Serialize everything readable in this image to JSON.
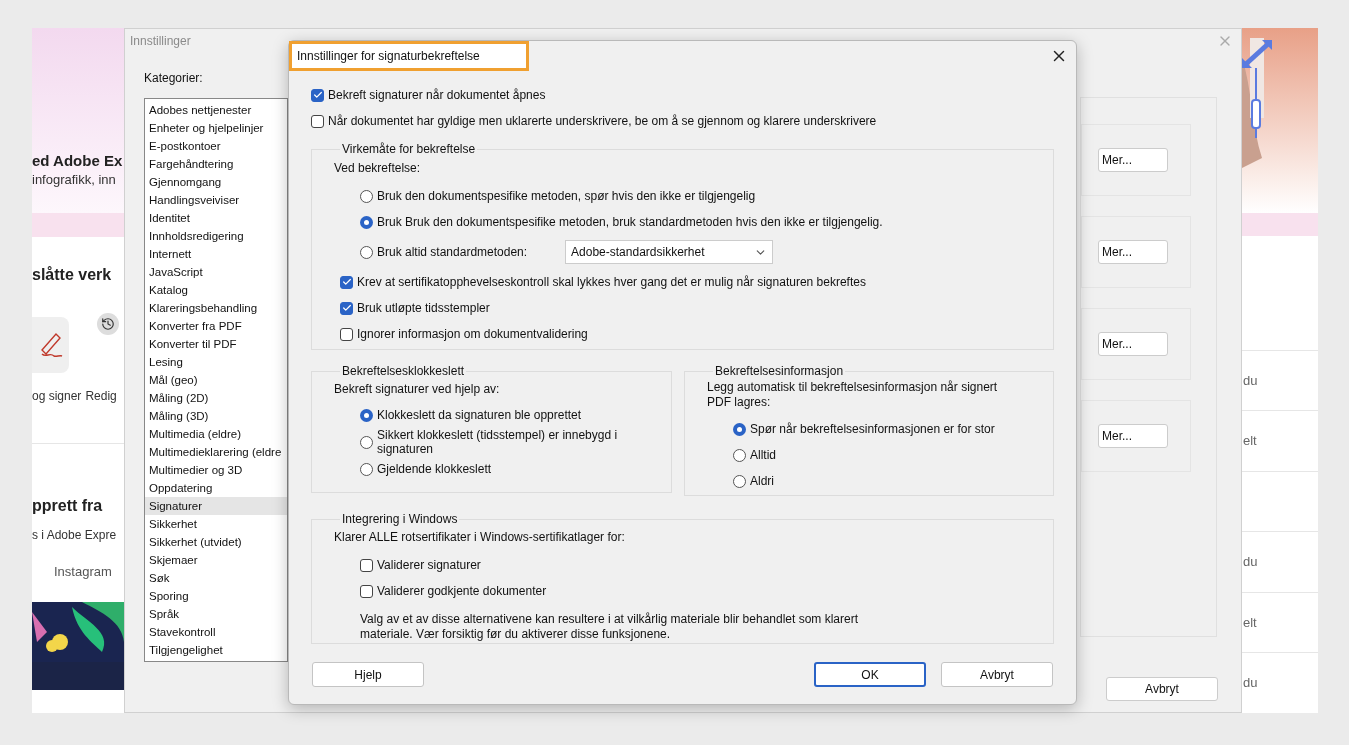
{
  "background_page": {
    "heading": "ed Adobe Ex",
    "subtitle": "infografikk, inn",
    "tools_title": "slåtte verk",
    "tools": [
      {
        "label": "og signer"
      },
      {
        "label": "Redig"
      }
    ],
    "create_title": "pprett fra",
    "create_subtitle": "s i Adobe Expre",
    "tab": "Instagram",
    "right_rows": [
      "du",
      "elt",
      "",
      "du",
      "elt",
      "du"
    ]
  },
  "settings_window": {
    "title": "Innstillinger",
    "categories_label": "Kategorier:",
    "categories": [
      {
        "label": "Adobes nettjenester",
        "selected": false
      },
      {
        "label": "Enheter og hjelpelinjer",
        "selected": false
      },
      {
        "label": "E-postkontoer",
        "selected": false
      },
      {
        "label": "Fargehåndtering",
        "selected": false
      },
      {
        "label": "Gjennomgang",
        "selected": false
      },
      {
        "label": "Handlingsveiviser",
        "selected": false
      },
      {
        "label": "Identitet",
        "selected": false
      },
      {
        "label": "Innholdsredigering",
        "selected": false
      },
      {
        "label": "Internett",
        "selected": false
      },
      {
        "label": "JavaScript",
        "selected": false
      },
      {
        "label": "Katalog",
        "selected": false
      },
      {
        "label": "Klareringsbehandling",
        "selected": false
      },
      {
        "label": "Konverter fra PDF",
        "selected": false
      },
      {
        "label": "Konverter til PDF",
        "selected": false
      },
      {
        "label": "Lesing",
        "selected": false
      },
      {
        "label": "Mål (geo)",
        "selected": false
      },
      {
        "label": "Måling (2D)",
        "selected": false
      },
      {
        "label": "Måling (3D)",
        "selected": false
      },
      {
        "label": "Multimedia (eldre)",
        "selected": false
      },
      {
        "label": "Multimedieklarering (eldre",
        "selected": false
      },
      {
        "label": "Multimedier og 3D",
        "selected": false
      },
      {
        "label": "Oppdatering",
        "selected": false
      },
      {
        "label": "Signaturer",
        "selected": true
      },
      {
        "label": "Sikkerhet",
        "selected": false
      },
      {
        "label": "Sikkerhet (utvidet)",
        "selected": false
      },
      {
        "label": "Skjemaer",
        "selected": false
      },
      {
        "label": "Søk",
        "selected": false
      },
      {
        "label": "Sporing",
        "selected": false
      },
      {
        "label": "Språk",
        "selected": false
      },
      {
        "label": "Stavekontroll",
        "selected": false
      },
      {
        "label": "Tilgjengelighet",
        "selected": false
      }
    ],
    "more_buttons": [
      "Mer...",
      "Mer...",
      "Mer...",
      "Mer..."
    ],
    "cancel_button": "Avbryt"
  },
  "dialog": {
    "title": "Innstillinger for signaturbekreftelse",
    "top_options": [
      {
        "label": "Bekreft signaturer når dokumentet åpnes",
        "checked": true
      },
      {
        "label": "Når dokumentet har gyldige men uklarerte underskrivere, be om å se gjennom og klarere underskrivere",
        "checked": false
      }
    ],
    "behavior_group": {
      "title": "Virkemåte for bekreftelse",
      "prompt": "Ved bekreftelse:",
      "methods": [
        {
          "label": "Bruk den dokumentspesifike metoden, spør hvis den ikke er tilgjengelig",
          "selected": false
        },
        {
          "label": "Bruk Bruk den dokumentspesifike metoden, bruk standardmetoden hvis den ikke er tilgjengelig.",
          "selected": true
        },
        {
          "label": "Bruk altid standardmetoden:",
          "selected": false
        }
      ],
      "method_dropdown": {
        "value": "Adobe-standardsikkerhet"
      },
      "options": [
        {
          "label": "Krev at sertifikatopphevelseskontroll skal lykkes hver gang det er mulig når signaturen bekreftes",
          "checked": true
        },
        {
          "label": "Bruk utløpte tidsstempler",
          "checked": true
        },
        {
          "label": "Ignorer informasjon om dokumentvalidering",
          "checked": false
        }
      ]
    },
    "time_group": {
      "title": "Bekreftelsesklokkeslett",
      "prompt": "Bekreft signaturer ved hjelp av:",
      "choices": [
        {
          "label": "Klokkeslett da signaturen ble opprettet",
          "selected": true
        },
        {
          "label": "Sikkert klokkeslett (tidsstempel) er innebygd i signaturen",
          "selected": false
        },
        {
          "label": "Gjeldende klokkeslett",
          "selected": false
        }
      ]
    },
    "info_group": {
      "title": "Bekreftelsesinformasjon",
      "prompt": "Legg automatisk til bekreftelsesinformasjon når signert PDF lagres:",
      "choices": [
        {
          "label": "Spør når bekreftelsesinformasjonen er for stor",
          "selected": true
        },
        {
          "label": "Alltid",
          "selected": false
        },
        {
          "label": "Aldri",
          "selected": false
        }
      ]
    },
    "windows_group": {
      "title": "Integrering i Windows",
      "prompt": "Klarer ALLE rotsertifikater i Windows-sertifikatlager for:",
      "options": [
        {
          "label": "Validerer signaturer",
          "checked": false
        },
        {
          "label": "Validerer godkjente dokumenter",
          "checked": false
        }
      ],
      "note": "Valg av et av disse alternativene kan resultere i at vilkårlig materiale blir behandlet som klarert materiale. Vær forsiktig før du aktiverer disse funksjonene."
    },
    "buttons": [
      {
        "label": "Hjelp",
        "default": false
      },
      {
        "label": "OK",
        "default": true
      },
      {
        "label": "Avbryt",
        "default": false
      }
    ]
  }
}
